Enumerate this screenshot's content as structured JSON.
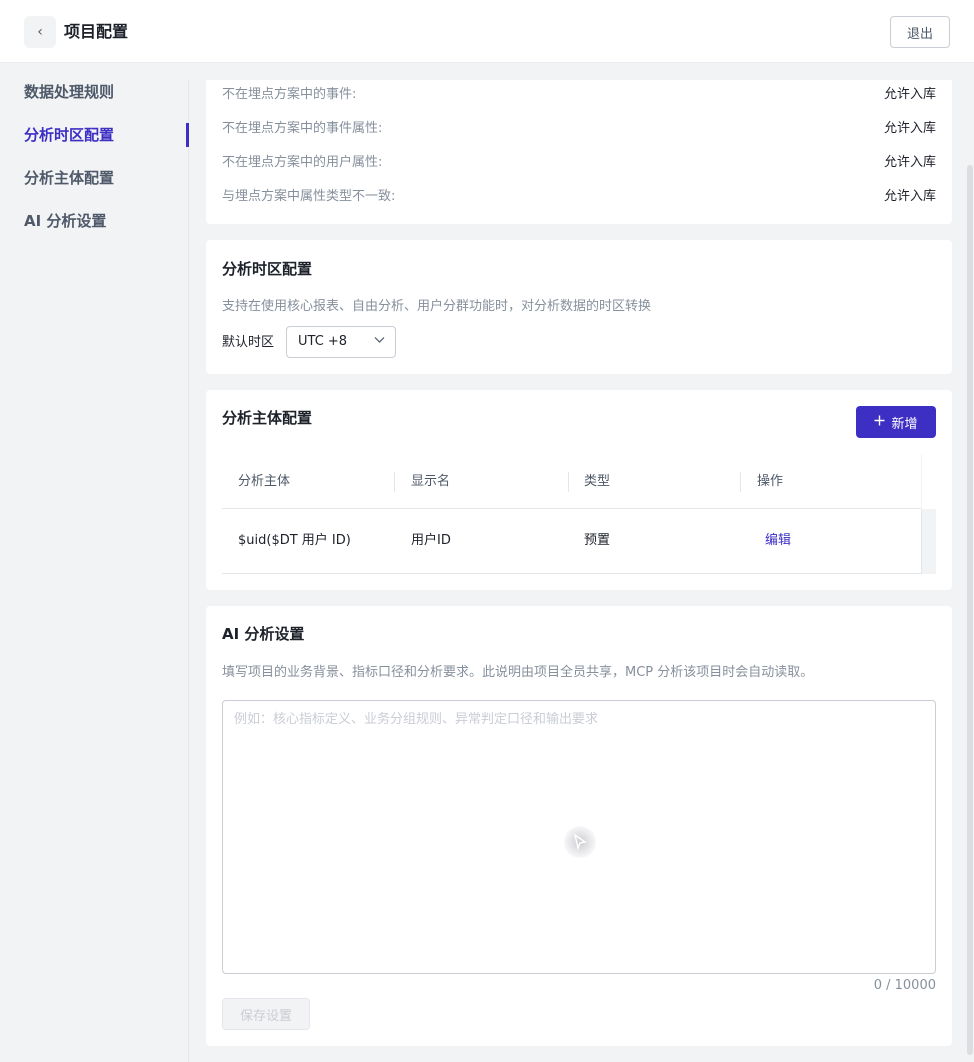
{
  "header": {
    "back_icon": "‹",
    "title": "项目配置",
    "exit_label": "退出"
  },
  "sidebar": {
    "items": [
      {
        "label": "数据处理规则",
        "active": false
      },
      {
        "label": "分析时区配置",
        "active": true
      },
      {
        "label": "分析主体配置",
        "active": false
      },
      {
        "label": "AI 分析设置",
        "active": false
      }
    ]
  },
  "rules": {
    "items": [
      {
        "label": "不在埋点方案中的事件:",
        "value": "允许入库"
      },
      {
        "label": "不在埋点方案中的事件属性:",
        "value": "允许入库"
      },
      {
        "label": "不在埋点方案中的用户属性:",
        "value": "允许入库"
      },
      {
        "label": "与埋点方案中属性类型不一致:",
        "value": "允许入库"
      }
    ]
  },
  "timezone": {
    "title": "分析时区配置",
    "description": "支持在使用核心报表、自由分析、用户分群功能时，对分析数据的时区转换",
    "label": "默认时区",
    "selected": "UTC +8"
  },
  "subject": {
    "title": "分析主体配置",
    "add_label": "新增",
    "columns": [
      "分析主体",
      "显示名",
      "类型",
      "操作"
    ],
    "rows": [
      {
        "subject": "$uid($DT 用户 ID)",
        "display_name": "用户ID",
        "type": "预置",
        "action": "编辑"
      }
    ]
  },
  "ai": {
    "title": "AI 分析设置",
    "description": "填写项目的业务背景、指标口径和分析要求。此说明由项目全员共享，MCP 分析该项目时会自动读取。",
    "placeholder": "例如：核心指标定义、业务分组规则、异常判定口径和输出要求",
    "counter": "0 / 10000",
    "save_label": "保存设置"
  },
  "colors": {
    "accent": "#3d2ec4",
    "background": "#f2f3f5"
  }
}
